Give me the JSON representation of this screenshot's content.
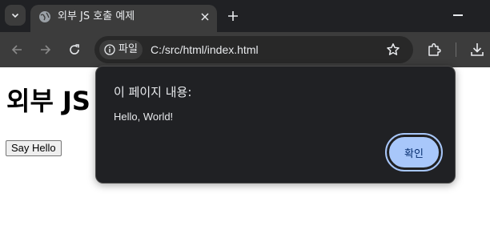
{
  "browser": {
    "tab": {
      "title": "외부 JS 호출 예제"
    },
    "address": {
      "chip_label": "파일",
      "url": "C:/src/html/index.html"
    },
    "icons": {
      "tab_search": "chevron-down-icon",
      "favicon": "globe-icon",
      "tab_close": "close-icon",
      "new_tab": "plus-icon",
      "minimize": "minimize-icon",
      "back": "arrow-left-icon",
      "forward": "arrow-right-icon",
      "reload": "reload-icon",
      "info": "info-icon",
      "bookmark": "star-icon",
      "extensions": "puzzle-icon",
      "download": "download-icon"
    }
  },
  "page": {
    "heading": "외부 JS",
    "button_label": "Say Hello"
  },
  "dialog": {
    "title": "이 페이지 내용:",
    "message": "Hello, World!",
    "ok_label": "확인"
  },
  "colors": {
    "frame": "#202124",
    "toolbar": "#3c3c3c",
    "accent": "#a8c7fa"
  }
}
